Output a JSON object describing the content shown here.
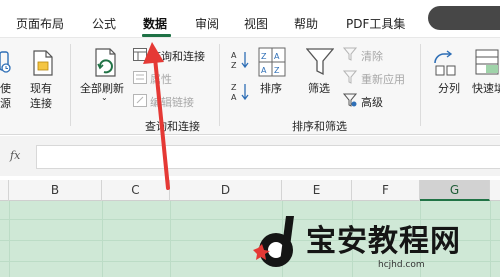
{
  "tabs": [
    {
      "label": "页面布局"
    },
    {
      "label": "公式"
    },
    {
      "label": "数据",
      "active": true
    },
    {
      "label": "审阅"
    },
    {
      "label": "视图"
    },
    {
      "label": "帮助"
    },
    {
      "label": "PDF工具集"
    }
  ],
  "ribbon": {
    "partial_left_a": "使",
    "partial_left_b": "源",
    "existing_connections_a": "现有",
    "existing_connections_b": "连接",
    "refresh_all": "全部刷新",
    "queries_connections": "查询和连接",
    "properties": "属性",
    "edit_links": "编辑链接",
    "queries_group_label": "查询和连接",
    "sort": "排序",
    "filter": "筛选",
    "clear": "清除",
    "reapply": "重新应用",
    "advanced": "高级",
    "sort_filter_group_label": "排序和筛选",
    "text_to_columns": "分列",
    "flash_fill_partial": "快速填"
  },
  "formula_bar": {
    "fx_label": "fx",
    "value": ""
  },
  "columns": [
    "B",
    "C",
    "D",
    "E",
    "F",
    "G"
  ],
  "selected_column": "G",
  "watermark": {
    "title": "宝安教程网",
    "url": "hcjhd.com"
  },
  "colors": {
    "accent": "#1e7145",
    "arrow": "#e53935",
    "grid_fill": "#cfe8d6",
    "watermark_red": "#e53935"
  }
}
